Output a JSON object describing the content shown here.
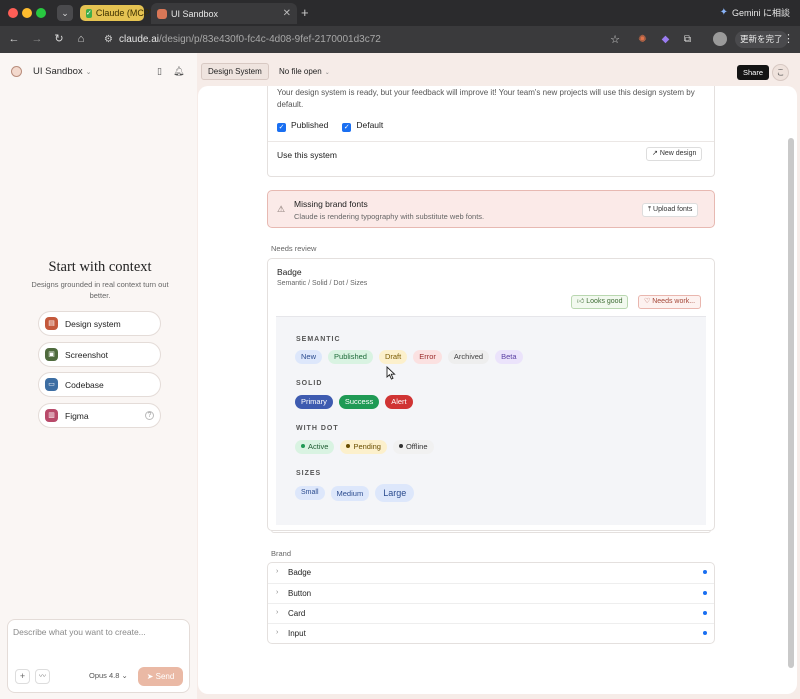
{
  "browser": {
    "tabs": [
      {
        "label": "Claude (MCP)"
      },
      {
        "label": "UI Sandbox"
      }
    ],
    "url_host": "claude.ai",
    "url_path": "/design/p/83e430f0-fc4c-4d08-9fef-2170001d3c72",
    "gemini_label": "Gemini に相談",
    "update_label": "更新を完了"
  },
  "sidebar": {
    "project_name": "UI Sandbox",
    "context_title": "Start with context",
    "context_subtitle": "Designs grounded in real context turn out better.",
    "context_buttons": [
      {
        "label": "Design system"
      },
      {
        "label": "Screenshot"
      },
      {
        "label": "Codebase"
      },
      {
        "label": "Figma"
      }
    ],
    "composer_placeholder": "Describe what you want to create...",
    "model": "Opus 4.8",
    "send_label": "Send"
  },
  "topbar": {
    "active_tab": "Design System",
    "file_dropdown": "No file open",
    "share_label": "Share",
    "user_initial": "こ"
  },
  "design_system_card": {
    "description": "Your design system is ready, but your feedback will improve it! Your team's new projects will use this design system by default.",
    "published_label": "Published",
    "default_label": "Default",
    "use_label": "Use this system",
    "new_design_label": "New design"
  },
  "alert": {
    "title": "Missing brand fonts",
    "subtitle": "Claude is rendering typography with substitute web fonts.",
    "upload_label": "Upload fonts"
  },
  "needs_review": {
    "section_label": "Needs review",
    "component_name": "Badge",
    "component_variants": "Semantic / Solid / Dot / Sizes",
    "looks_good_label": "Looks good",
    "needs_work_label": "Needs work...",
    "groups": {
      "semantic": {
        "heading": "SEMANTIC",
        "badges": [
          "New",
          "Published",
          "Draft",
          "Error",
          "Archived",
          "Beta"
        ]
      },
      "solid": {
        "heading": "SOLID",
        "badges": [
          "Primary",
          "Success",
          "Alert"
        ]
      },
      "with_dot": {
        "heading": "WITH DOT",
        "badges": [
          "Active",
          "Pending",
          "Offline"
        ]
      },
      "sizes": {
        "heading": "SIZES",
        "badges": [
          "Small",
          "Medium",
          "Large"
        ]
      }
    }
  },
  "brand": {
    "section_label": "Brand",
    "items": [
      {
        "label": "Badge"
      },
      {
        "label": "Button"
      },
      {
        "label": "Card"
      },
      {
        "label": "Input"
      }
    ]
  },
  "colors": {
    "accent": "#d97757",
    "checkbox_blue": "#1a6ff1",
    "alert_bg": "#fbeae8"
  }
}
